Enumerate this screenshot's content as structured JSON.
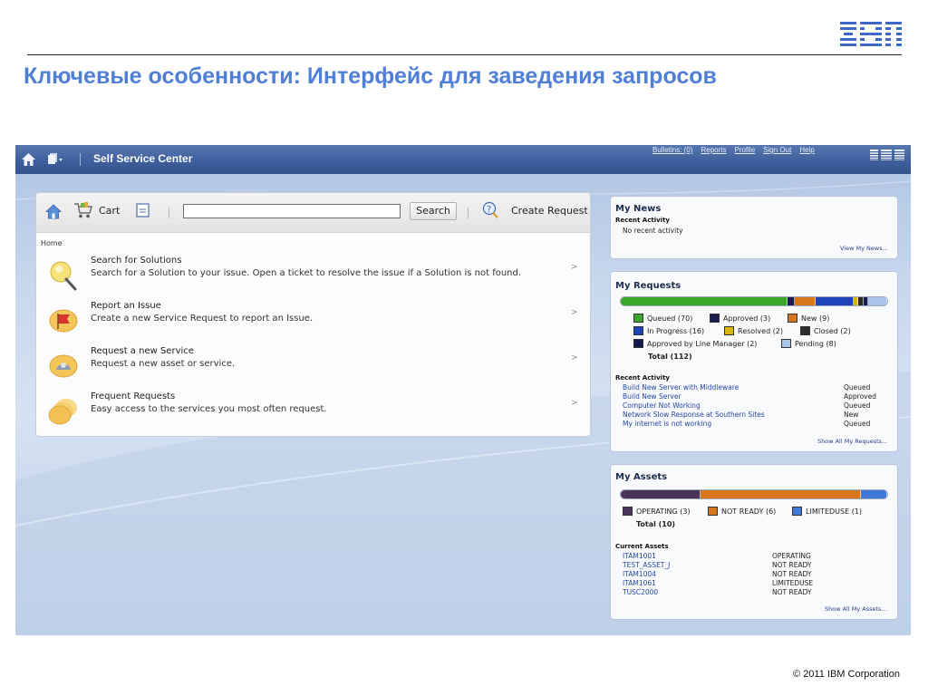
{
  "slide": {
    "title": "Ключевые особенности: Интерфейс для заведения запросов",
    "footer": "© 2011 IBM Corporation",
    "logo": "IBM"
  },
  "appbar": {
    "title": "Self Service Center",
    "links": [
      "Bulletins: (0)",
      "Reports",
      "Profile",
      "Sign Out",
      "Help"
    ],
    "logo": "IBM"
  },
  "toolbar": {
    "cart_label": "Cart",
    "search_value": "",
    "search_button": "Search",
    "create_request": "Create Request"
  },
  "breadcrumb": "Home",
  "menu": [
    {
      "title": "Search for Solutions",
      "desc": "Search for a Solution to your issue. Open a ticket to resolve the issue if a Solution is not found.",
      "icon": "lightbulb-search-icon"
    },
    {
      "title": "Report an Issue",
      "desc": "Create a new Service Request to report an Issue.",
      "icon": "flag-issue-icon"
    },
    {
      "title": "Request a new Service",
      "desc": "Request a new asset or service.",
      "icon": "service-request-icon"
    },
    {
      "title": "Frequent Requests",
      "desc": "Easy access to the services you most often request.",
      "icon": "frequent-requests-icon"
    }
  ],
  "news": {
    "title": "My News",
    "recent_label": "Recent Activity",
    "no_activity": "No recent activity",
    "view_link": "View My News..."
  },
  "requests": {
    "title": "My Requests",
    "legend": [
      {
        "label": "Queued (70)",
        "color": "#3aa62a",
        "count": 70
      },
      {
        "label": "Approved (3)",
        "color": "#1b1d50",
        "count": 3
      },
      {
        "label": "New (9)",
        "color": "#d8761a",
        "count": 9
      },
      {
        "label": "In Progress (16)",
        "color": "#1f43b8",
        "count": 16
      },
      {
        "label": "Resolved (2)",
        "color": "#d8b412",
        "count": 2
      },
      {
        "label": "Closed (2)",
        "color": "#2b2b2b",
        "count": 2
      },
      {
        "label": "Approved by Line Manager (2)",
        "color": "#141a4e",
        "count": 2
      },
      {
        "label": "Pending (8)",
        "color": "#a8c4ea",
        "count": 8
      }
    ],
    "total": "Total (112)",
    "recent_label": "Recent Activity",
    "activity": [
      {
        "name": "Build New Server with Middleware",
        "status": "Queued"
      },
      {
        "name": "Build New Server",
        "status": "Approved"
      },
      {
        "name": "Computer Not Working",
        "status": "Queued"
      },
      {
        "name": "Network Slow Response at Southern Sites",
        "status": "New"
      },
      {
        "name": "My internet is not working",
        "status": "Queued"
      }
    ],
    "show_all": "Show All My Requests..."
  },
  "assets": {
    "title": "My Assets",
    "legend": [
      {
        "label": "OPERATING (3)",
        "color": "#4a3358",
        "count": 3
      },
      {
        "label": "NOT READY (6)",
        "color": "#d8761a",
        "count": 6
      },
      {
        "label": "LIMITEDUSE (1)",
        "color": "#3c79d8",
        "count": 1
      }
    ],
    "total": "Total (10)",
    "current_label": "Current Assets",
    "items": [
      {
        "id": "ITAM1001",
        "status": "OPERATING"
      },
      {
        "id": "TEST_ASSET_J",
        "status": "NOT READY"
      },
      {
        "id": "ITAM1004",
        "status": "NOT READY"
      },
      {
        "id": "ITAM1061",
        "status": "LIMITEDUSE"
      },
      {
        "id": "TUSC2000",
        "status": "NOT READY"
      }
    ],
    "show_all": "Show All My Assets..."
  }
}
